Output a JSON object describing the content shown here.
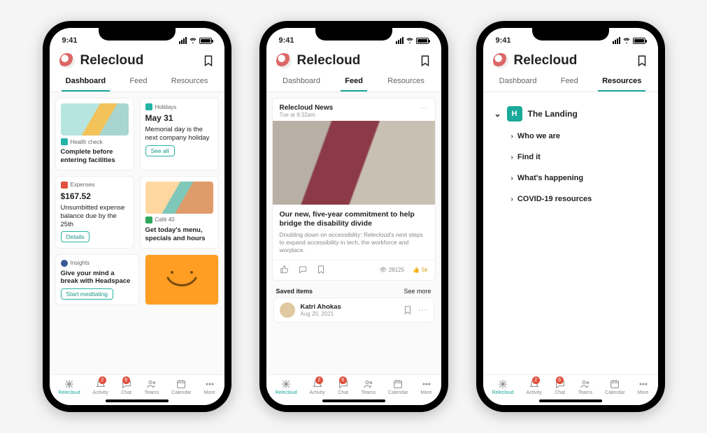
{
  "status": {
    "time": "9:41"
  },
  "app": {
    "title": "Relecloud"
  },
  "tabs": [
    "Dashboard",
    "Feed",
    "Resources"
  ],
  "dashboard": {
    "health": {
      "label": "Health check",
      "text": "Complete before entering facilities"
    },
    "holidays": {
      "label": "Holidays",
      "date": "May 31",
      "text": "Memorial day is the next company holiday",
      "cta": "See all"
    },
    "expenses": {
      "label": "Expenses",
      "amount": "$167.52",
      "text": "Unsumbitted expense balance due by the 25th",
      "cta": "Details"
    },
    "cafe": {
      "label": "Café 40",
      "text": "Get today's menu, specials and hours"
    },
    "insights": {
      "label": "Insights",
      "text": "Give your mind a break with Headspace",
      "cta": "Start meditating"
    }
  },
  "feed": {
    "source": "Relecloud News",
    "time": "Tue at 9:32am",
    "title": "Our new, five-year commitment to help bridge the disability divide",
    "desc": "Doubling down on accessibility: Relecloud's next steps to expand accessibility in tech, the workforce and worplace.",
    "views": "28125",
    "reacts": "5k",
    "saved_label": "Saved items",
    "saved_more": "See more",
    "saved": {
      "name": "Katri Ahokas",
      "date": "Aug 20, 2021"
    }
  },
  "resources": {
    "group": "The Landing",
    "items": [
      "Who we are",
      "Find it",
      "What's happening",
      "COVID-19 resources"
    ]
  },
  "nav": {
    "items": [
      "Relecloud",
      "Activity",
      "Chat",
      "Teams",
      "Calendar",
      "More"
    ],
    "badges": {
      "activity": "2",
      "chat": "6"
    }
  }
}
